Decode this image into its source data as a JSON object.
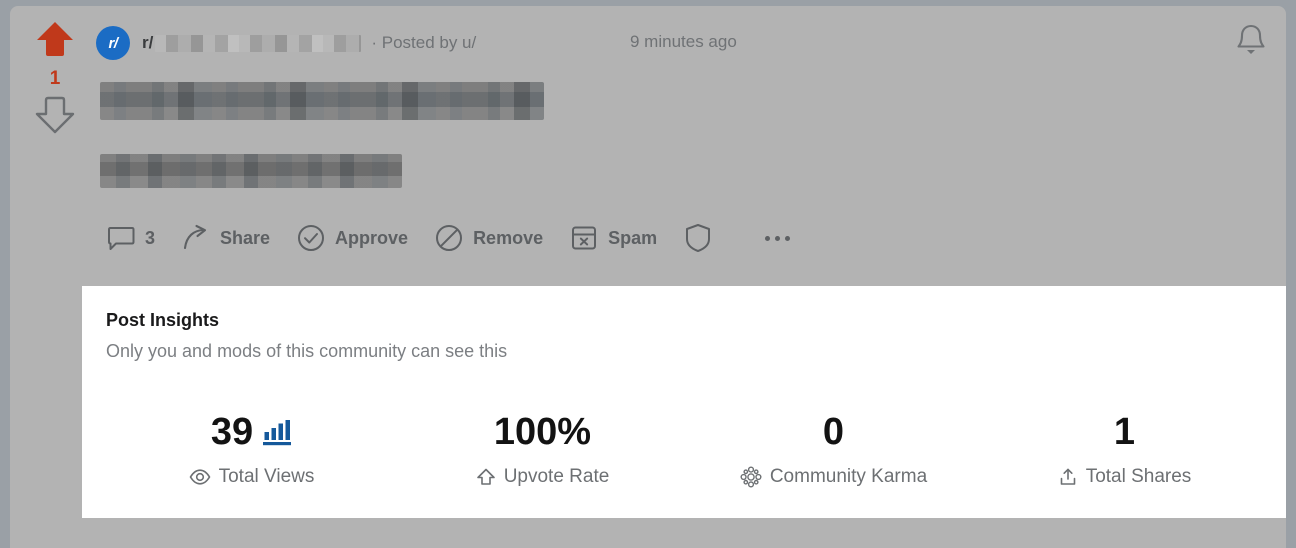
{
  "post": {
    "vote": {
      "score": "1",
      "upvote_icon": "arrow-up-filled-icon",
      "downvote_icon": "arrow-down-outline-icon",
      "upvote_color": "#c0391b"
    },
    "subreddit": {
      "avatar_label": "r/",
      "avatar_color": "#1b6cc4",
      "prefix": "r/",
      "name_redacted": true
    },
    "byline": "· Posted by u/",
    "timestamp": "9 minutes ago",
    "title_redacted": true,
    "body_redacted": true
  },
  "header": {
    "bell_icon": "bell-icon"
  },
  "actions": [
    {
      "label": "3",
      "icon": "comment-bubble-icon",
      "name": "comments-button"
    },
    {
      "label": "Share",
      "icon": "share-arrow-icon",
      "name": "share-button"
    },
    {
      "label": "Approve",
      "icon": "check-circle-icon",
      "name": "approve-button"
    },
    {
      "label": "Remove",
      "icon": "no-entry-icon",
      "name": "remove-button"
    },
    {
      "label": "Spam",
      "icon": "spam-box-icon",
      "name": "spam-button"
    },
    {
      "label": "",
      "icon": "shield-icon",
      "name": "mod-shield-button"
    }
  ],
  "more_actions": {
    "icon": "ellipsis-icon",
    "label": "..."
  },
  "insights": {
    "title": "Post Insights",
    "subtitle": "Only you and mods of this community can see this",
    "chart_icon_color": "#15599b",
    "stats": [
      {
        "value": "39",
        "label": "Total Views",
        "label_icon": "eye-icon",
        "value_icon": "bar-chart-icon"
      },
      {
        "value": "100%",
        "label": "Upvote Rate",
        "label_icon": "arrow-up-outline-icon",
        "value_icon": ""
      },
      {
        "value": "0",
        "label": "Community Karma",
        "label_icon": "karma-flower-icon",
        "value_icon": ""
      },
      {
        "value": "1",
        "label": "Total Shares",
        "label_icon": "share-upload-icon",
        "value_icon": ""
      }
    ]
  }
}
